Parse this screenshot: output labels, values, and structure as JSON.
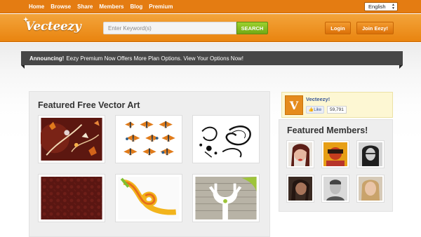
{
  "topnav": {
    "items": [
      "Home",
      "Browse",
      "Share",
      "Members",
      "Blog",
      "Premium"
    ]
  },
  "language": {
    "selected": "English"
  },
  "logo": {
    "text": "Vecteezy"
  },
  "search": {
    "placeholder": "Enter Keyword(s)",
    "button": "SEARCH"
  },
  "header_buttons": {
    "login": "Login",
    "join": "Join Eezy!"
  },
  "announcement": {
    "lead": "Announcing!",
    "text": "Eezy Premium Now Offers More Plan Options. View Your Options Now!"
  },
  "featured": {
    "title": "Featured Free Vector Art",
    "thumbnails": [
      "floral-autumn",
      "butterflies",
      "paisley",
      "damask-pattern",
      "ribbon-swirl",
      "deer-antlers"
    ]
  },
  "facebook": {
    "logo_letter": "V",
    "page_name": "Vecteezy!",
    "like_label": "Like",
    "like_count": "59,791"
  },
  "members": {
    "title": "Featured Members!",
    "avatars": [
      "member-1",
      "member-2",
      "member-3",
      "member-4",
      "member-5",
      "member-6"
    ]
  },
  "colors": {
    "brand_orange": "#e9840f",
    "search_green": "#8cc423",
    "announce_bar": "#474747",
    "facebook_blue": "#3b5998"
  }
}
